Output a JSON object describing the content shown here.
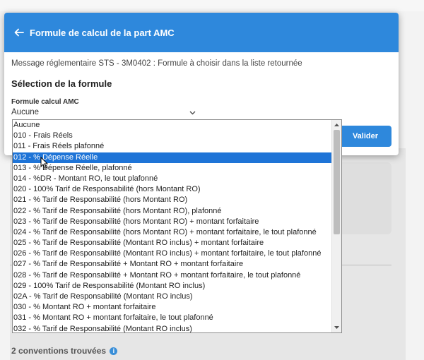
{
  "dialog": {
    "title": "Formule de calcul de la part AMC",
    "message": "Message réglementaire STS - 3M0402 : Formule à choisir dans la liste retournée",
    "section_title": "Sélection de la formule",
    "field_label": "Formule calcul AMC",
    "selected_value": "Aucune",
    "validate_label": "Valider"
  },
  "dropdown": {
    "options": [
      "Aucune",
      "010 - Frais Réels",
      "011 - Frais Réels plafonné",
      "012 - % Dépense Réelle",
      "013 - % Dépense Réelle, plafonné",
      "014 - %DR - Montant RO, le tout plafonné",
      "020 - 100% Tarif de Responsabilité (hors Montant RO)",
      "021 - % Tarif de Responsabilité (hors Montant RO)",
      "022 - % Tarif de Responsabilité (hors Montant RO), plafonné",
      "023 - % Tarif de Responsabilité (hors Montant RO) + montant forfaitaire",
      "024 - % Tarif de Responsabilité (hors Montant RO) + montant forfaitaire, le tout plafonné",
      "025 - % Tarif de Responsabilité (Montant RO inclus) + montant forfaitaire",
      "026 - % Tarif de Responsabilité (Montant RO inclus) + montant forfaitaire, le tout plafonné",
      "027 - % Tarif de Responsabilité + Montant RO + montant forfaitaire",
      "028 - % Tarif de Responsabilité + Montant RO + montant forfaitaire, le tout plafonné",
      "029 - 100% Tarif de Responsabilité (Montant RO inclus)",
      "02A - % Tarif de Responsabilité (Montant RO inclus)",
      "030 - % Montant RO + montant forfaitaire",
      "031 - % Montant RO + montant forfaitaire, le tout plafonné",
      "032 - % Tarif de Responsabilité (Montant RO inclus)"
    ],
    "highlighted_index": 3
  },
  "background": {
    "conventions_text": "2 conventions trouvées",
    "info_icon": "i"
  },
  "colors": {
    "accent": "#2e88dc",
    "highlight": "#1e74d7"
  }
}
